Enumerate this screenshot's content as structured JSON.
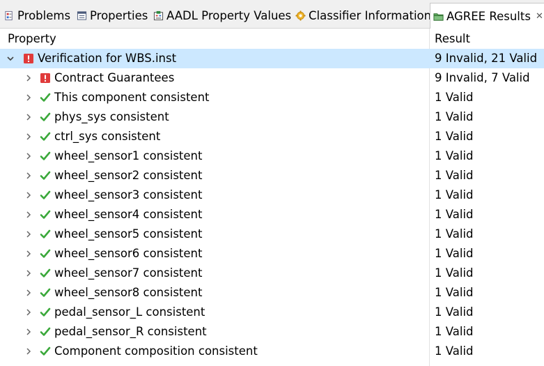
{
  "tabs": [
    {
      "label": "Problems",
      "icon": "problems-icon",
      "active": false
    },
    {
      "label": "Properties",
      "icon": "properties-icon",
      "active": false
    },
    {
      "label": "AADL Property Values",
      "icon": "aadl-property-values-icon",
      "active": false
    },
    {
      "label": "Classifier Information",
      "icon": "classifier-information-icon",
      "active": false
    },
    {
      "label": "AGREE Results",
      "icon": "agree-results-icon",
      "active": true,
      "close_glyph": "✕"
    }
  ],
  "columns": {
    "property": "Property",
    "result": "Result"
  },
  "tree": {
    "root": {
      "label": "Verification for WBS.inst",
      "result": "9 Invalid, 21 Valid",
      "status": "invalid",
      "expanded": true
    },
    "children": [
      {
        "label": "Contract Guarantees",
        "result": "9 Invalid, 7 Valid",
        "status": "invalid"
      },
      {
        "label": "This component consistent",
        "result": "1 Valid",
        "status": "valid"
      },
      {
        "label": "phys_sys consistent",
        "result": "1 Valid",
        "status": "valid"
      },
      {
        "label": "ctrl_sys consistent",
        "result": "1 Valid",
        "status": "valid"
      },
      {
        "label": "wheel_sensor1 consistent",
        "result": "1 Valid",
        "status": "valid"
      },
      {
        "label": "wheel_sensor2 consistent",
        "result": "1 Valid",
        "status": "valid"
      },
      {
        "label": "wheel_sensor3 consistent",
        "result": "1 Valid",
        "status": "valid"
      },
      {
        "label": "wheel_sensor4 consistent",
        "result": "1 Valid",
        "status": "valid"
      },
      {
        "label": "wheel_sensor5 consistent",
        "result": "1 Valid",
        "status": "valid"
      },
      {
        "label": "wheel_sensor6 consistent",
        "result": "1 Valid",
        "status": "valid"
      },
      {
        "label": "wheel_sensor7 consistent",
        "result": "1 Valid",
        "status": "valid"
      },
      {
        "label": "wheel_sensor8 consistent",
        "result": "1 Valid",
        "status": "valid"
      },
      {
        "label": "pedal_sensor_L consistent",
        "result": "1 Valid",
        "status": "valid"
      },
      {
        "label": "pedal_sensor_R consistent",
        "result": "1 Valid",
        "status": "valid"
      },
      {
        "label": "Component composition consistent",
        "result": "1 Valid",
        "status": "valid"
      }
    ]
  },
  "colors": {
    "selection": "#cce8ff",
    "invalid": "#e03b3b",
    "valid": "#3aa83a",
    "tab_bar": "#f0f0f0"
  }
}
